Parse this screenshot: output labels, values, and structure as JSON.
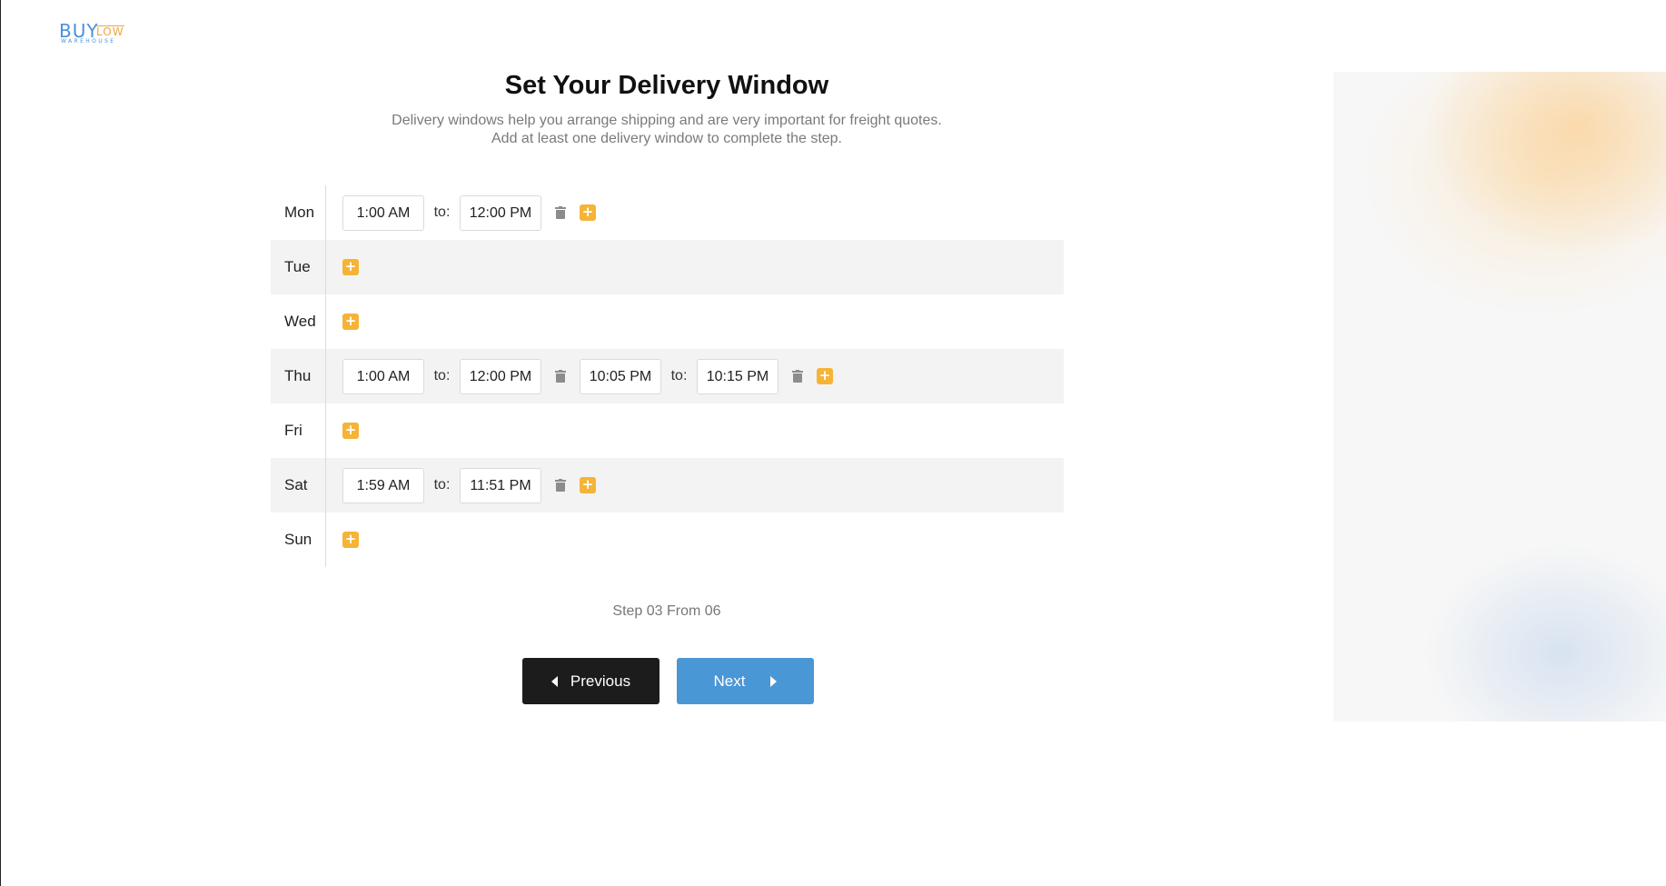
{
  "logo": {
    "buy": "BUY",
    "low": "LOW",
    "warehouse": "WAREHOUSE"
  },
  "header": {
    "title": "Set Your Delivery Window",
    "subtitle_line1": "Delivery windows help you arrange shipping and are very important for freight quotes.",
    "subtitle_line2": "Add at least one delivery window to complete the step."
  },
  "schedule": {
    "to_label": "to:",
    "days": [
      {
        "label": "Mon",
        "windows": [
          {
            "from": "1:00 AM",
            "to": "12:00 PM"
          }
        ]
      },
      {
        "label": "Tue",
        "windows": []
      },
      {
        "label": "Wed",
        "windows": []
      },
      {
        "label": "Thu",
        "windows": [
          {
            "from": "1:00 AM",
            "to": "12:00 PM"
          },
          {
            "from": "10:05 PM",
            "to": "10:15 PM"
          }
        ]
      },
      {
        "label": "Fri",
        "windows": []
      },
      {
        "label": "Sat",
        "windows": [
          {
            "from": "1:59 AM",
            "to": "11:51 PM"
          }
        ]
      },
      {
        "label": "Sun",
        "windows": []
      }
    ]
  },
  "step": {
    "text": "Step 03 From 06"
  },
  "nav": {
    "previous_label": "Previous",
    "next_label": "Next"
  },
  "colors": {
    "accent_plus": "#f5b437",
    "next_button": "#4a97d6",
    "previous_button": "#1c1c1c"
  }
}
